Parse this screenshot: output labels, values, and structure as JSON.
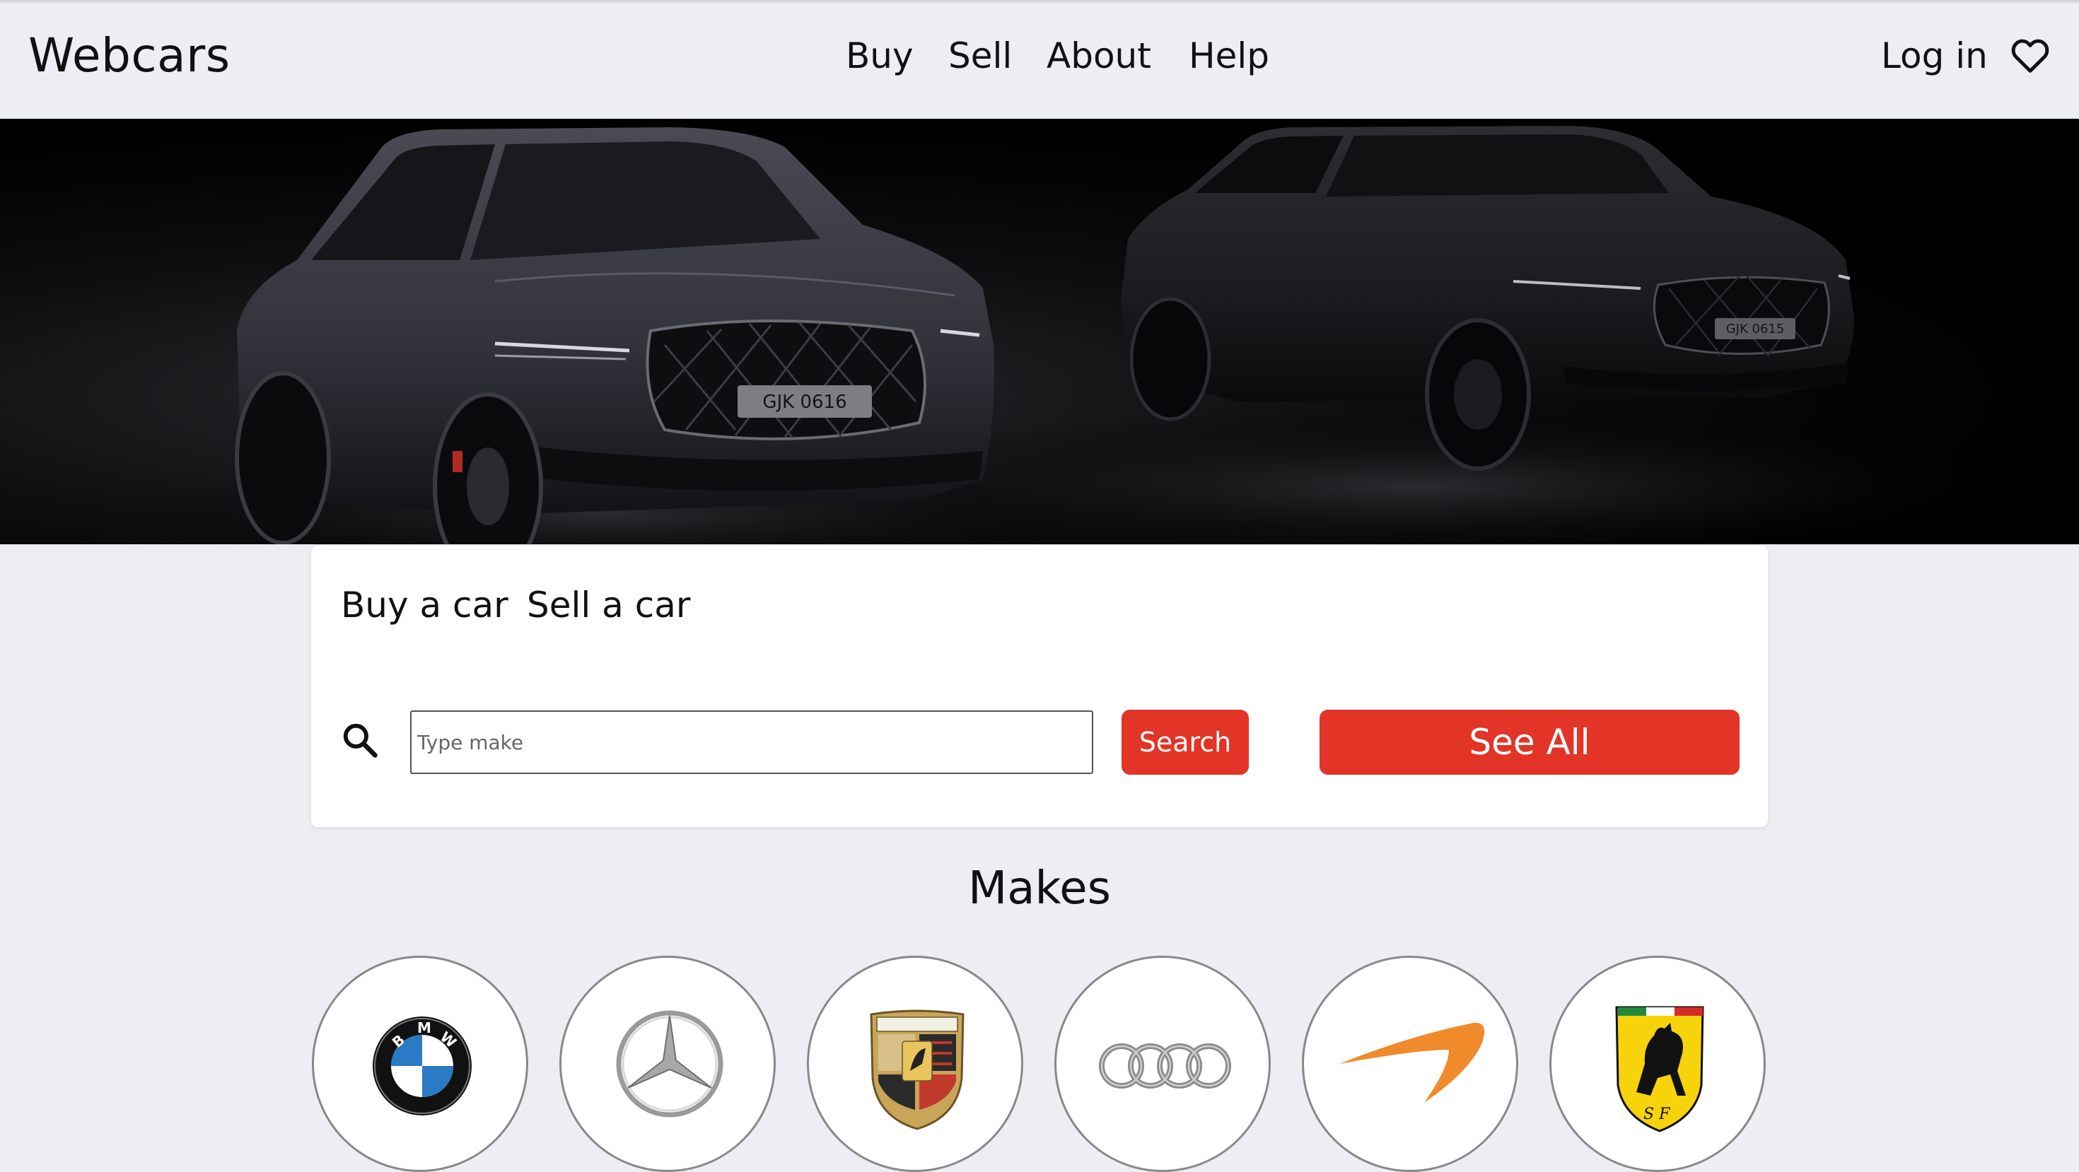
{
  "header": {
    "brand": "Webcars",
    "nav": [
      "Buy",
      "Sell",
      "About",
      "Help"
    ],
    "login": "Log in"
  },
  "hero": {
    "plates": [
      "GJK 0616",
      "GJK 0615"
    ]
  },
  "search_card": {
    "tabs": [
      "Buy a car",
      "Sell a car"
    ],
    "input_placeholder": "Type make",
    "search_label": "Search",
    "see_all_label": "See All"
  },
  "makes": {
    "title": "Makes",
    "items": [
      "bmw-logo",
      "mercedes-logo",
      "porsche-logo",
      "audi-logo",
      "mclaren-logo",
      "ferrari-logo"
    ]
  },
  "colors": {
    "accent": "#e23427",
    "background": "#eceef3"
  }
}
